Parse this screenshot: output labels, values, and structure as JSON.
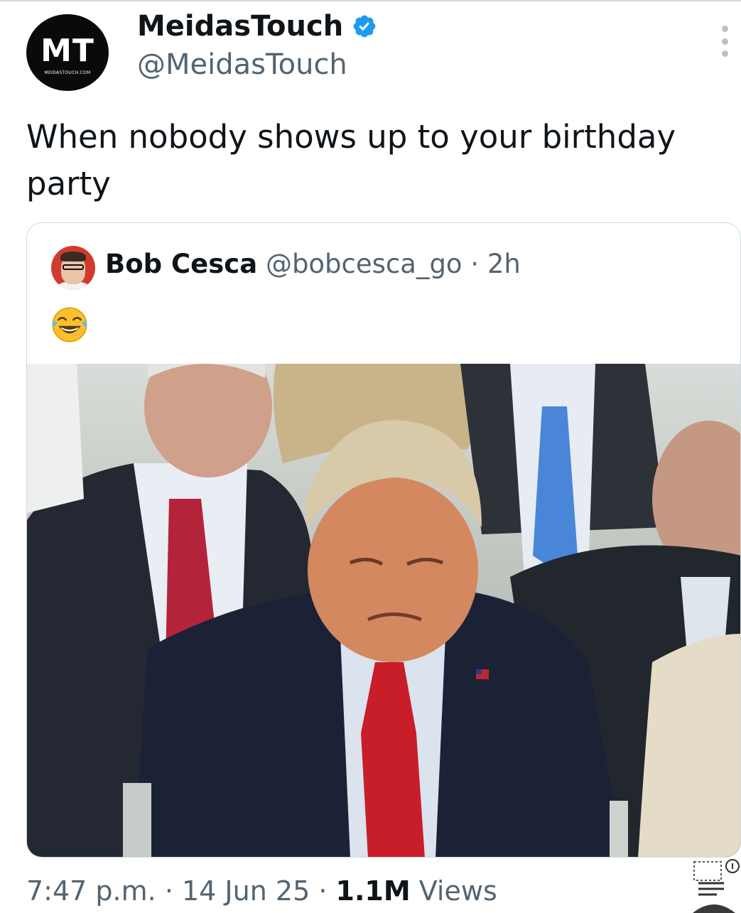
{
  "tweet": {
    "author": {
      "display_name": "MeidasTouch",
      "handle": "@MeidasTouch",
      "avatar_text": "MT",
      "avatar_subtext": "MEIDASTOUCH.COM",
      "verified": true
    },
    "text": "When nobody shows up to your birthday party",
    "quoted_tweet": {
      "author_name": "Bob Cesca",
      "author_handle": "@bobcesca_go",
      "separator": "·",
      "time_ago": "2h",
      "text_emoji": "face-with-tears-of-joy",
      "media": "photo of men in suits seated in a crowd"
    },
    "meta": {
      "time": "7:47 p.m.",
      "separator": "·",
      "date": "14 Jun 25",
      "views_count": "1.1M",
      "views_label": "Views"
    }
  },
  "colors": {
    "text_primary": "#0f1419",
    "text_secondary": "#536471",
    "verified_blue": "#1d9bf0",
    "border": "#cfd9de",
    "tie_red": "#c81e2a"
  },
  "icons": {
    "verified": "verified-badge-icon",
    "more": "more-options-icon",
    "emoji": "laughing-emoji-icon",
    "corner": "media-controls-icon"
  }
}
